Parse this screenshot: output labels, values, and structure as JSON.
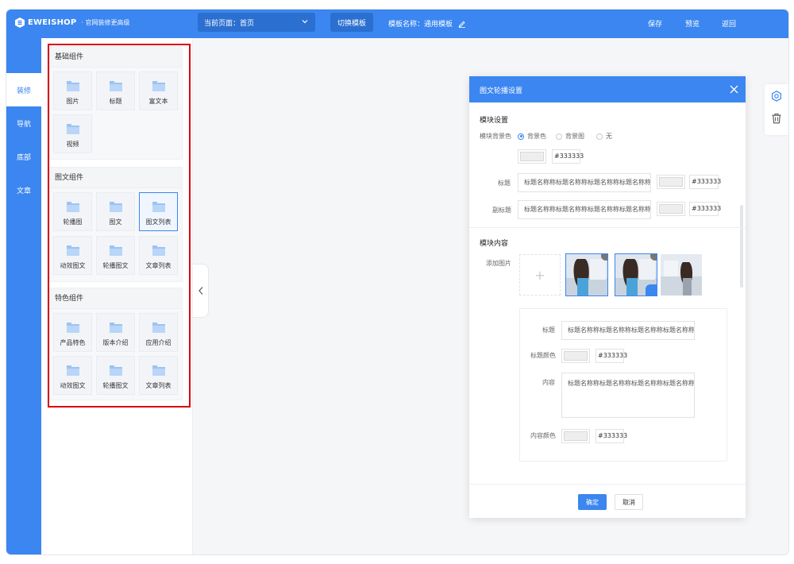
{
  "topbar": {
    "brand": "EWEISHOP",
    "brand_sub": "· 官网装修更高级",
    "page_select": "当前页面：首页",
    "switch_template": "切换模板",
    "template_name": "模板名称：通用模板",
    "save": "保存",
    "preview": "预览",
    "back": "返回",
    "color": "#3b86f0"
  },
  "leftnav": {
    "items": [
      {
        "label": "装修",
        "active": true
      },
      {
        "label": "导航",
        "active": false
      },
      {
        "label": "底部",
        "active": false
      },
      {
        "label": "文章",
        "active": false
      }
    ]
  },
  "components": {
    "groups": [
      {
        "title": "基础组件",
        "items": [
          "图片",
          "标题",
          "富文本",
          "视频"
        ]
      },
      {
        "title": "图文组件",
        "items": [
          "轮播图",
          "图文",
          "图文列表",
          "动效图文",
          "轮播图文",
          "文章列表"
        ],
        "selected": "图文列表"
      },
      {
        "title": "特色组件",
        "items": [
          "产品特色",
          "版本介绍",
          "应用介绍",
          "动效图文",
          "轮播图文",
          "文章列表"
        ]
      }
    ]
  },
  "modal": {
    "title": "图文轮播设置",
    "module_settings": "模块设置",
    "bg_label": "模块背景色",
    "bg_options": [
      "背景色",
      "背景图",
      "无"
    ],
    "bg_selected": "背景色",
    "bg_hex": "#333333",
    "title_label": "标题",
    "title_value": "标题名称称标题名称称标题名称称标题名称称",
    "title_hex": "#333333",
    "subtitle_label": "副标题",
    "subtitle_value": "标题名称称标题名称称标题名称称标题名称称",
    "subtitle_hex": "#333333",
    "module_content": "模块内容",
    "add_image_label": "添加图片",
    "add_symbol": "+",
    "item": {
      "title_label": "标题",
      "title_value": "标题名称称标题名称称标题名称称标题名称称",
      "title_color_label": "标题颜色",
      "title_color_hex": "#333333",
      "content_label": "内容",
      "content_value": "标题名称称标题名称称标题名称称标题名称称",
      "content_color_label": "内容颜色",
      "content_color_hex": "#333333"
    },
    "ok": "确定",
    "cancel": "取消"
  }
}
